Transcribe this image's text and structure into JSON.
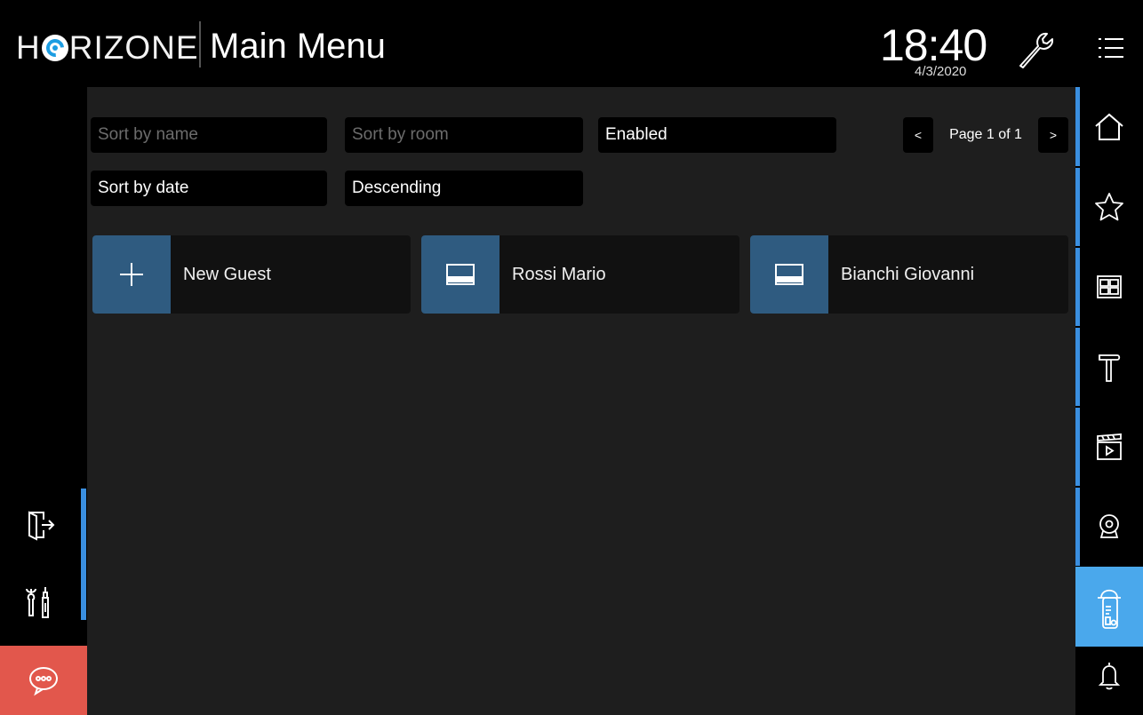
{
  "header": {
    "brand_prefix": "H",
    "brand_suffix": "RIZONE",
    "title": "Main Menu",
    "time": "18:40",
    "date": "4/3/2020"
  },
  "filters": {
    "sort_name_placeholder": "Sort by name",
    "sort_room_placeholder": "Sort by room",
    "status": "Enabled",
    "sort_date": "Sort by date",
    "order": "Descending"
  },
  "pager": {
    "prev": "<",
    "label": "Page 1 of 1",
    "next": ">"
  },
  "cards": [
    {
      "label": "New Guest",
      "icon": "plus-icon"
    },
    {
      "label": "Rossi Mario",
      "icon": "guest-card-icon"
    },
    {
      "label": "Bianchi Giovanni",
      "icon": "guest-card-icon"
    }
  ],
  "right_nav": [
    "home-icon",
    "star-icon",
    "grid-icon",
    "hammer-icon",
    "clapperboard-icon",
    "camera-icon",
    "door-hanger-icon",
    "bell-icon"
  ],
  "left_nav": [
    "logout-icon",
    "tools-icon",
    "chat-icon"
  ],
  "colors": {
    "accent": "#3a8fe0",
    "active_nav": "#4aa8ec",
    "card_icon_bg": "#2f5b80",
    "chat_button": "#e2574c"
  }
}
